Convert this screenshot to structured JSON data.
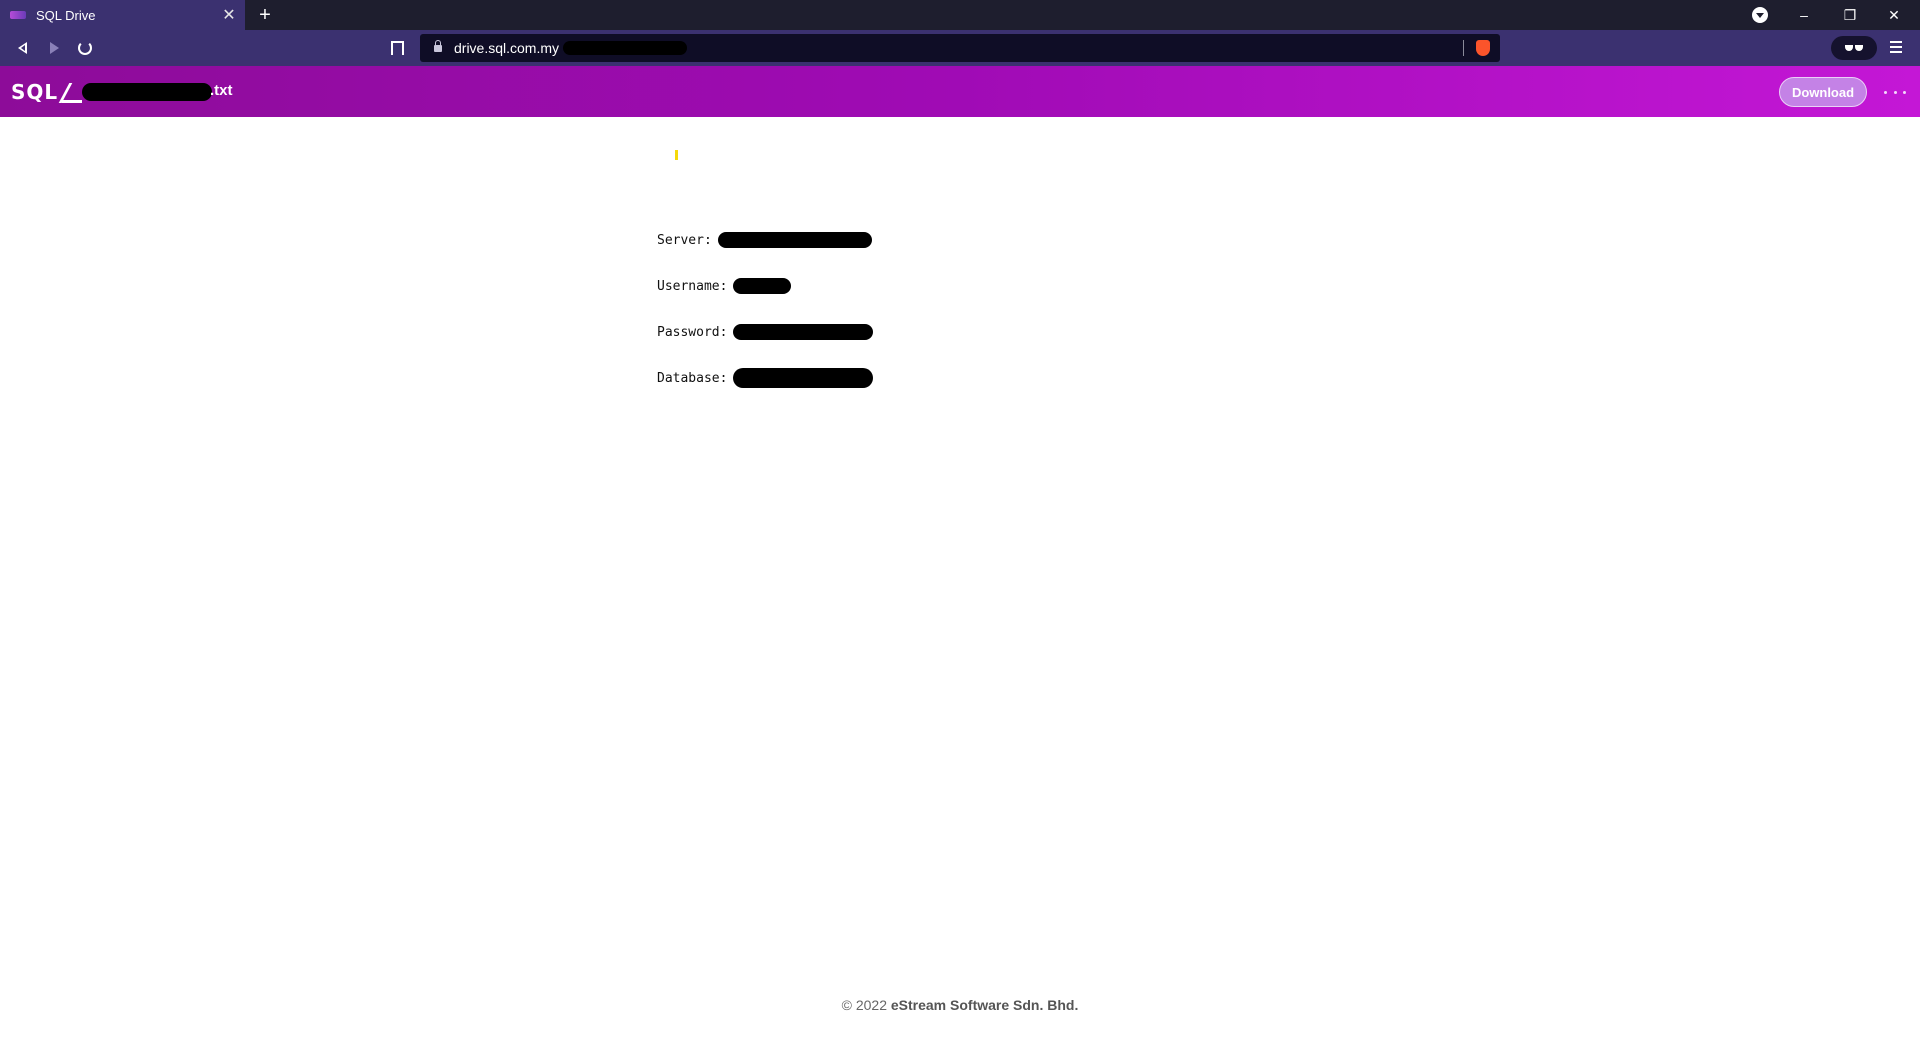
{
  "browser": {
    "tab_title": "SQL Drive",
    "tab_close": "✕",
    "new_tab": "+",
    "url": "drive.sql.com.my",
    "window_controls": {
      "minimize": "–",
      "restore": "❐",
      "close": "✕"
    }
  },
  "app": {
    "logo": "SQL",
    "file_name_suffix": ".txt",
    "download_label": "Download"
  },
  "content": {
    "fields": [
      {
        "label": "Server:"
      },
      {
        "label": "Username:"
      },
      {
        "label": "Password:"
      },
      {
        "label": "Database:"
      }
    ]
  },
  "footer": {
    "copyright": "© 2022",
    "company": "eStream Software Sdn. Bhd."
  },
  "colors": {
    "tab_bar": "#1e1e2e",
    "nav_bar": "#3b3170",
    "app_header_start": "#8d0c99",
    "app_header_end": "#c417d6"
  }
}
